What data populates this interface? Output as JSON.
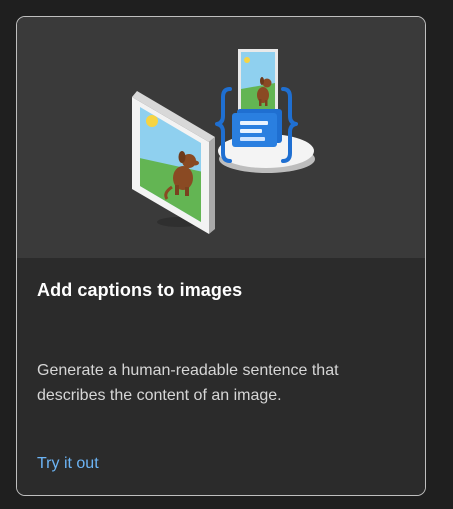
{
  "card": {
    "title": "Add captions to images",
    "description": "Generate a human-readable sentence that describes the content of an image.",
    "link_label": "Try it out"
  },
  "colors": {
    "card_background": "#2b2b2b",
    "hero_background": "#3a3a3a",
    "card_border": "#bfbfbf",
    "title_text": "#ffffff",
    "description_text": "#d6d6d6",
    "link_text": "#6cb4f5",
    "accent_blue": "#1f6fd1"
  },
  "icons": {
    "hero_illustration": "image-caption-illustration",
    "photo": "photo-frame-icon",
    "caption_card": "caption-card-icon",
    "braces": "curly-braces-icon"
  }
}
